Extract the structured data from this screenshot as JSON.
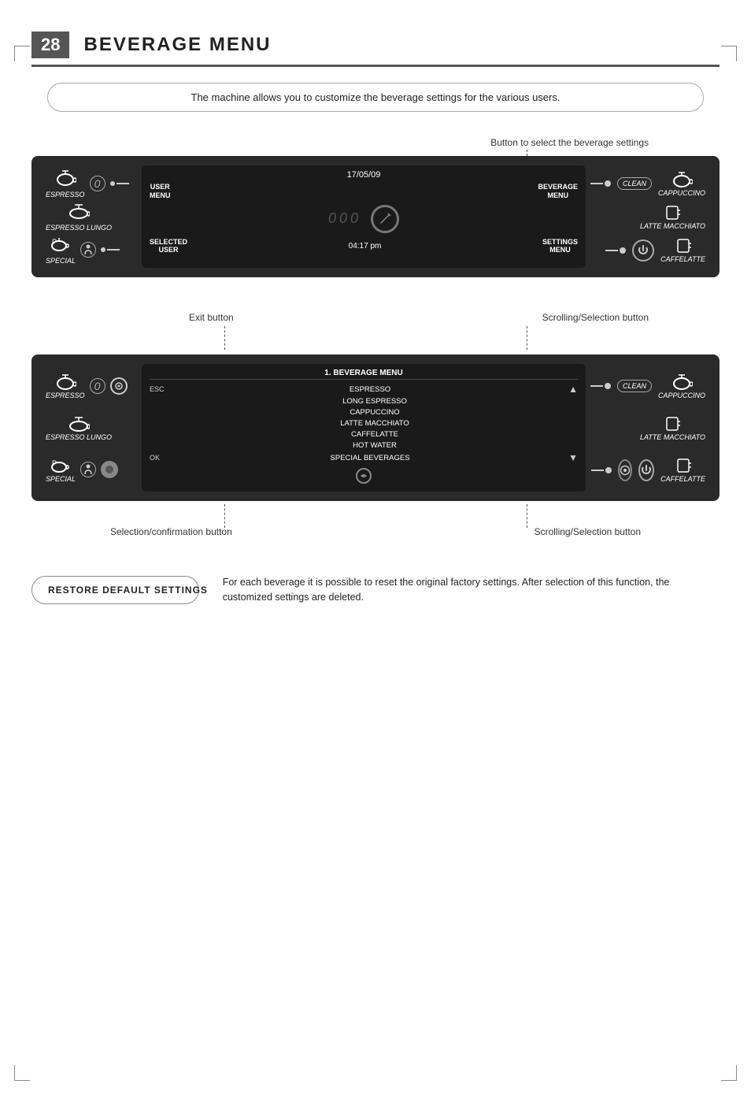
{
  "page": {
    "number": "28",
    "title": "BEVERAGE MENU"
  },
  "description": "The machine allows you to customize the beverage settings for the various users.",
  "annotation_top": "Button to select the beverage settings",
  "machine1": {
    "date": "17/05/09",
    "time": "04:17 pm",
    "user_menu_label": "USER\nMENU",
    "beverage_menu_label": "BEVERAGE\nMENU",
    "selected_user_label": "SELECTED\nUSER",
    "settings_menu_label": "SETTINGS\nMENU",
    "left_beverages": [
      {
        "icon": "☕",
        "label": "ESPRESSO"
      },
      {
        "icon": "☕",
        "label": "ESPRESSO LUNGO"
      },
      {
        "icon": "♨",
        "label": "SPECIAL"
      }
    ],
    "right_beverages": [
      {
        "icon": "☕",
        "label": "CAPPUCCINO"
      },
      {
        "icon": "▬",
        "label": "LATTE MACCHIATO"
      },
      {
        "icon": "▬",
        "label": "CAFFELATTE"
      }
    ],
    "clean_label": "CLEAN"
  },
  "annotation_exit": "Exit button",
  "annotation_scroll_top": "Scrolling/Selection button",
  "annotation_confirm": "Selection/confirmation button",
  "annotation_scroll_bottom": "Scrolling/Selection button",
  "machine2": {
    "menu_title": "1. BEVERAGE MENU",
    "menu_items": [
      {
        "key": "ESC",
        "text": "ESPRESSO",
        "arrow": "up"
      },
      {
        "key": "",
        "text": "LONG ESPRESSO"
      },
      {
        "key": "",
        "text": "CAPPUCCINO"
      },
      {
        "key": "",
        "text": "LATTE MACCHIATO"
      },
      {
        "key": "",
        "text": "CAFFELATTE"
      },
      {
        "key": "",
        "text": "HOT WATER"
      },
      {
        "key": "OK",
        "text": "SPECIAL BEVERAGES",
        "arrow": "down"
      }
    ]
  },
  "restore": {
    "button_label": "RESTORE DEFAULT SETTINGS",
    "description": "For each beverage it is possible to reset the original factory settings. After selection of this function, the customized settings are deleted."
  }
}
